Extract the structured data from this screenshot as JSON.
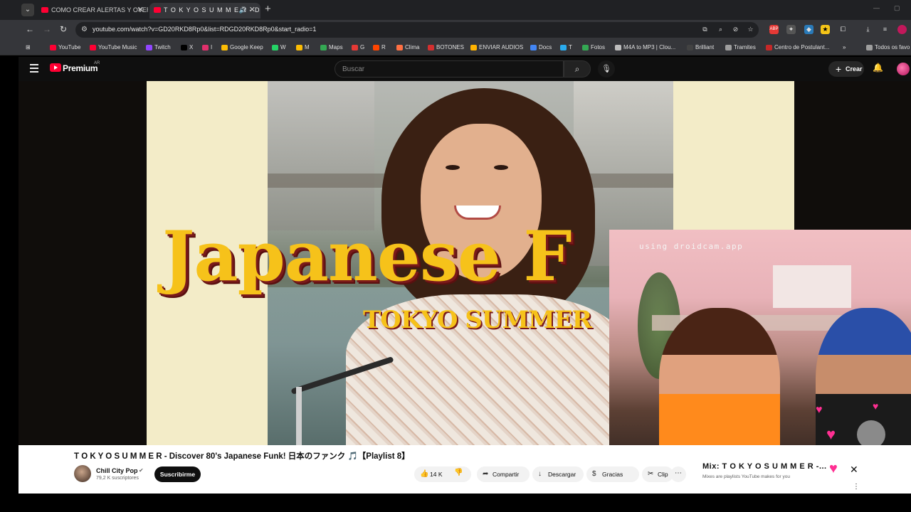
{
  "browser": {
    "tabs": [
      {
        "title": "COMO CREAR ALERTAS Y OVERL"
      },
      {
        "title": "T O K Y O   S U M M E R - D"
      }
    ],
    "url": "youtube.com/watch?v=GD20RKD8Rp0&list=RDGD20RKD8Rp0&start_radio=1",
    "bookmarks": [
      {
        "label": "YouTube",
        "color": "#ff0033"
      },
      {
        "label": "YouTube Music",
        "color": "#ff0033"
      },
      {
        "label": "Twitch",
        "color": "#9146ff"
      },
      {
        "label": "X",
        "color": "#000000"
      },
      {
        "label": "I",
        "color": "#e1306c"
      },
      {
        "label": "Google Keep",
        "color": "#fbbc04"
      },
      {
        "label": "W",
        "color": "#25d366"
      },
      {
        "label": "M",
        "color": "#fbbc04"
      },
      {
        "label": "Maps",
        "color": "#34a853"
      },
      {
        "label": "G",
        "color": "#e53935"
      },
      {
        "label": "R",
        "color": "#ff4500"
      },
      {
        "label": "Clima",
        "color": "#ff7043"
      },
      {
        "label": "BOTONES",
        "color": "#d32f2f"
      },
      {
        "label": "ENVIAR AUDIOS",
        "color": "#ffb300"
      },
      {
        "label": "Docs",
        "color": "#4285f4"
      },
      {
        "label": "T",
        "color": "#2aabee"
      },
      {
        "label": "Fotos",
        "color": "#34a853"
      },
      {
        "label": "M4A to MP3 | Clou...",
        "color": "#bdbdbd"
      },
      {
        "label": "Brilliant",
        "color": "#424242"
      },
      {
        "label": "Tramites",
        "color": "#9e9e9e"
      },
      {
        "label": "Centro de Postulant...",
        "color": "#c62828"
      },
      {
        "label": "Todos os favo",
        "color": "#9e9e9e"
      }
    ]
  },
  "youtube": {
    "brand": "Premium",
    "region": "AR",
    "search_placeholder": "Buscar",
    "create_label": "Crear"
  },
  "thumbnail": {
    "big_text": "Japanese F",
    "sub_text": "TOKYO SUMMER"
  },
  "webcam": {
    "watermark": "using droidcam.app"
  },
  "video": {
    "title": "T O K Y O   S U M M E R - Discover 80's Japanese Funk! 日本のファンク 🎵【Playlist 8】",
    "channel": "Chill City Pop",
    "subscribers": "79,2 K suscriptores",
    "subscribe_label": "Suscribirme",
    "likes": "14 K",
    "share_label": "Compartir",
    "download_label": "Descargar",
    "thanks_label": "Gracias",
    "clip_label": "Clip"
  },
  "mix": {
    "title": "Mix: T O K Y O   S U M M E R -...",
    "subtitle": "Mixes are playlists YouTube makes for you"
  }
}
